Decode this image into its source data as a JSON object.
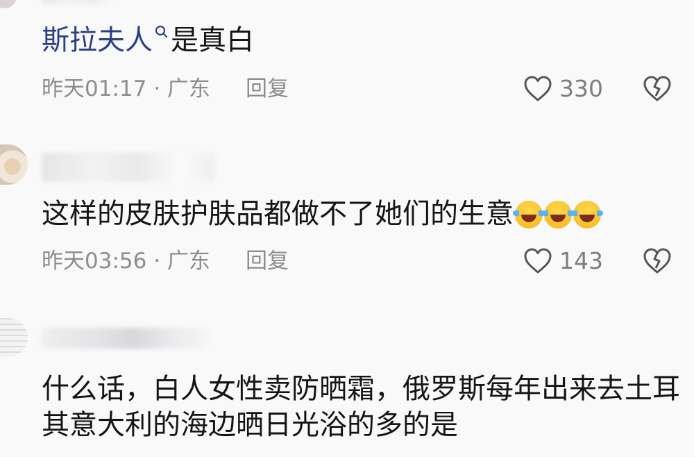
{
  "comments": [
    {
      "mention": "斯拉夫人",
      "text": "是真白",
      "time": "昨天01:17",
      "location": "广东",
      "reply_label": "回复",
      "likes": "330"
    },
    {
      "text": "这样的皮肤护肤品都做不了她们的生意",
      "time": "昨天03:56",
      "location": "广东",
      "reply_label": "回复",
      "likes": "143"
    },
    {
      "text_line1": "什么话，白人女性卖防晒霜，俄罗斯每年出来去土耳",
      "text_line2": "其意大利的海边晒日光浴的多的是"
    }
  ],
  "icons": {
    "like": "heart-outline-icon",
    "dislike": "broken-heart-icon",
    "search": "search-icon",
    "emoji": "laughing-crying-emoji"
  }
}
